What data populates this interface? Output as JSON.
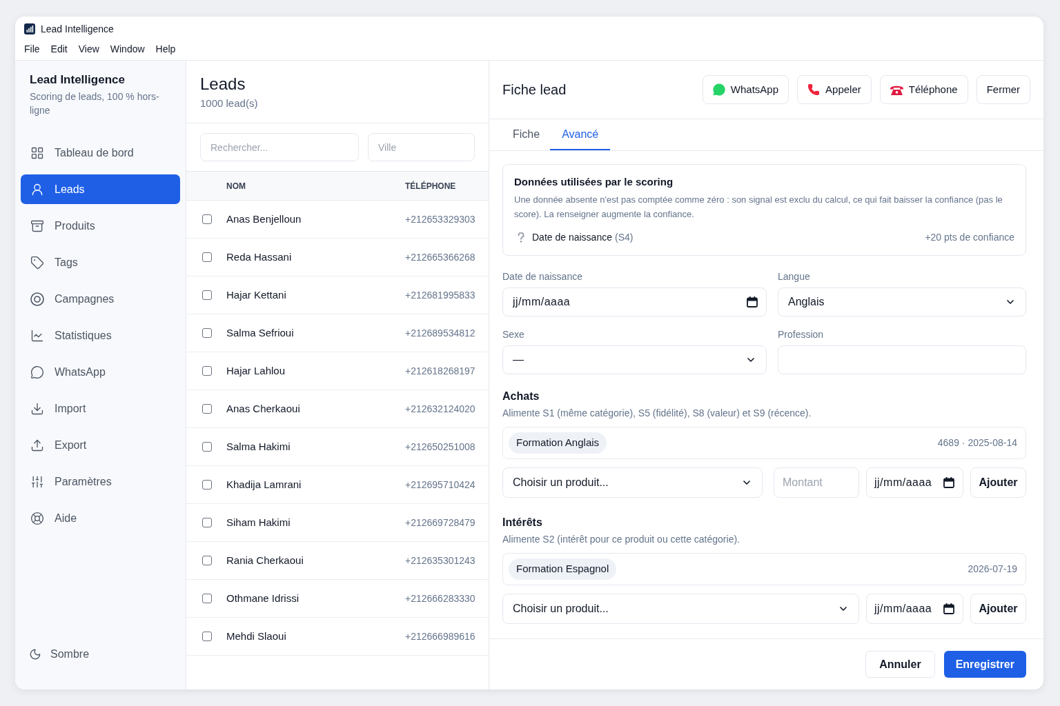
{
  "window": {
    "title": "Lead Intelligence",
    "menu": [
      "File",
      "Edit",
      "View",
      "Window",
      "Help"
    ]
  },
  "sidebar": {
    "title": "Lead Intelligence",
    "subtitle": "Scoring de leads, 100 % hors-ligne",
    "items": [
      {
        "label": "Tableau de bord",
        "selected": false
      },
      {
        "label": "Leads",
        "selected": true
      },
      {
        "label": "Produits",
        "selected": false
      },
      {
        "label": "Tags",
        "selected": false
      },
      {
        "label": "Campagnes",
        "selected": false
      },
      {
        "label": "Statistiques",
        "selected": false
      },
      {
        "label": "WhatsApp",
        "selected": false
      },
      {
        "label": "Import",
        "selected": false
      },
      {
        "label": "Export",
        "selected": false
      },
      {
        "label": "Paramètres",
        "selected": false
      },
      {
        "label": "Aide",
        "selected": false
      }
    ],
    "theme_toggle": "Sombre"
  },
  "leads": {
    "title": "Leads",
    "count": "1000 lead(s)",
    "search": {
      "placeholder": "Rechercher..."
    },
    "city_filter": {
      "placeholder": "Ville"
    },
    "columns": [
      "NOM",
      "TÉLÉPHONE"
    ],
    "rows": [
      {
        "name": "Anas Benjelloun",
        "phone": "+212653329303",
        "checked": false
      },
      {
        "name": "Reda Hassani",
        "phone": "+212665366268",
        "checked": false
      },
      {
        "name": "Hajar Kettani",
        "phone": "+212681995833",
        "checked": false
      },
      {
        "name": "Salma Sefrioui",
        "phone": "+212689534812",
        "checked": false
      },
      {
        "name": "Hajar Lahlou",
        "phone": "+212618268197",
        "checked": false
      },
      {
        "name": "Anas Cherkaoui",
        "phone": "+212632124020",
        "checked": false
      },
      {
        "name": "Salma Hakimi",
        "phone": "+212650251008",
        "checked": false
      },
      {
        "name": "Khadija Lamrani",
        "phone": "+212695710424",
        "checked": false
      },
      {
        "name": "Siham Hakimi",
        "phone": "+212669728479",
        "checked": false
      },
      {
        "name": "Rania Cherkaoui",
        "phone": "+212635301243",
        "checked": false
      },
      {
        "name": "Othmane Idrissi",
        "phone": "+212666283330",
        "checked": false
      },
      {
        "name": "Mehdi Slaoui",
        "phone": "+212666989616",
        "checked": false
      }
    ]
  },
  "detail": {
    "title": "Fiche lead",
    "actions": [
      {
        "label": "WhatsApp",
        "kind": "chat"
      },
      {
        "label": "Appeler",
        "kind": "call"
      },
      {
        "label": "Téléphone",
        "kind": "telephone"
      },
      {
        "label": "Fermer",
        "kind": "text"
      }
    ],
    "tabs": [
      {
        "label": "Fiche",
        "selected": false
      },
      {
        "label": "Avancé",
        "selected": true
      }
    ],
    "scoring": {
      "title": "Données utilisées par le scoring",
      "description": "Une donnée absente n'est pas comptée comme zéro : son signal est exclu du calcul, ce qui fait baisser la confiance (pas le score). La renseigner augmente la confiance.",
      "missing": [
        {
          "label": "Date de naissance",
          "code": "(S4)",
          "gain": "+20 pts de confiance"
        }
      ]
    },
    "fields": [
      {
        "label": "Date de naissance",
        "kind": "date",
        "placeholder": "jj/mm/aaaa"
      },
      {
        "label": "Langue",
        "kind": "select",
        "value": "Anglais"
      },
      {
        "label": "Sexe",
        "kind": "select",
        "value": "—"
      },
      {
        "label": "Profession",
        "kind": "text"
      }
    ],
    "purchases": {
      "title": "Achats",
      "description": "Alimente S1 (même catégorie), S5 (fidélité), S8 (valeur) et S9 (récence).",
      "items": [
        {
          "product": "Formation Anglais",
          "details": "4689 · 2025-08-14"
        }
      ],
      "form": {
        "product": "Choisir un produit...",
        "amount_placeholder": "Montant",
        "date_placeholder": "jj/mm/aaaa",
        "button": "Ajouter"
      }
    },
    "interests": {
      "title": "Intérêts",
      "description": "Alimente S2 (intérêt pour ce produit ou cette catégorie).",
      "items": [
        {
          "product": "Formation Espagnol",
          "details": "2026-07-19"
        }
      ],
      "form": {
        "product": "Choisir un produit...",
        "date_placeholder": "jj/mm/aaaa",
        "button": "Ajouter"
      }
    },
    "footer_buttons": [
      {
        "label": "Annuler",
        "kind": "secondary"
      },
      {
        "label": "Enregistrer",
        "kind": "primary"
      }
    ]
  }
}
